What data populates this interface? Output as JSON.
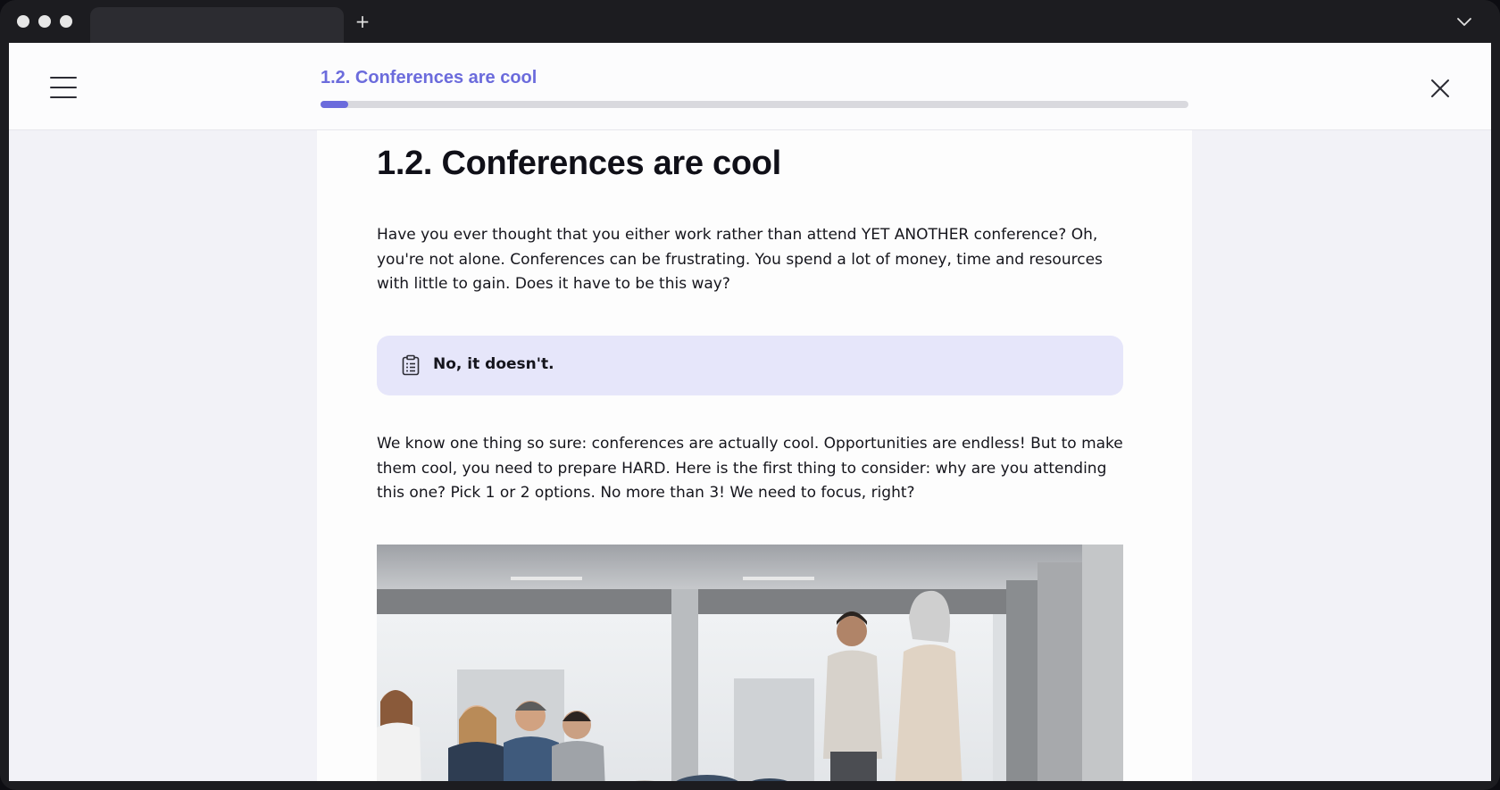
{
  "browser": {
    "new_tab_label": "+"
  },
  "header": {
    "course_title": "1.2. Conferences are cool",
    "progress": 0.032
  },
  "lesson": {
    "heading": "1.2. Conferences are cool",
    "paragraph_1": "Have you ever thought that you either work rather than attend YET ANOTHER conference? Oh, you're not alone. Conferences can be frustrating. You spend a lot of money, time and resources with little to gain. Does it have to be this way?",
    "callout": {
      "icon": "clipboard-icon",
      "text": "No, it doesn't."
    },
    "paragraph_2": "We know one thing so sure: conferences are actually cool. Opportunities are endless! But to make them cool, you need to prepare HARD. Here is the first thing to consider: why are you attending this one? Pick 1 or 2 options. No more than 3! We need to focus, right?",
    "image": {
      "subject": "business meeting photo"
    }
  },
  "colors": {
    "accent": "#6b6bdc",
    "callout_bg": "#e6e6fa",
    "page_bg": "#f2f2f7"
  }
}
